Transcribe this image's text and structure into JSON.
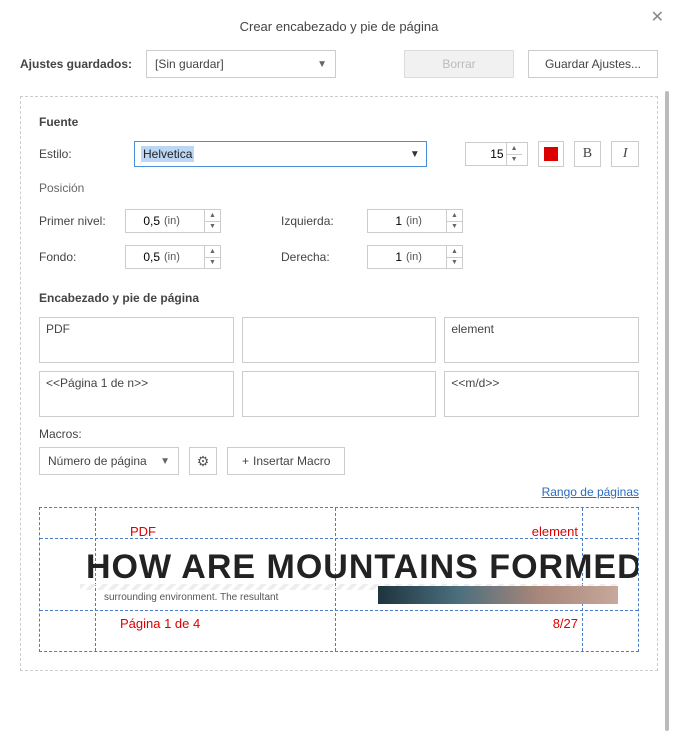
{
  "title": "Crear encabezado y pie de página",
  "top": {
    "saved_label": "Ajustes guardados:",
    "saved_value": "[Sin guardar]",
    "delete": "Borrar",
    "save": "Guardar Ajustes..."
  },
  "font": {
    "section": "Fuente",
    "style_label": "Estilo:",
    "family": "Helvetica",
    "size": "15",
    "color": "#d00000",
    "bold": "B",
    "italic": "I"
  },
  "position": {
    "section": "Posición",
    "first_label": "Primer nivel:",
    "first_value": "0,5",
    "first_unit": "(in)",
    "left_label": "Izquierda:",
    "left_value": "1",
    "left_unit": "(in)",
    "bottom_label": "Fondo:",
    "bottom_value": "0,5",
    "bottom_unit": "(in)",
    "right_label": "Derecha:",
    "right_value": "1",
    "right_unit": "(in)"
  },
  "hf": {
    "section": "Encabezado y pie de página",
    "h_left": "PDF",
    "h_center": "",
    "h_right": "element",
    "f_left": "<<Página 1 de n>>",
    "f_center": "",
    "f_right": "<<m/d>>"
  },
  "macros": {
    "label": "Macros:",
    "selected": "Número de página",
    "insert": "Insertar Macro",
    "range_link": "Rango de páginas"
  },
  "preview": {
    "headline": "HOW ARE MOUNTAINS FORMED?",
    "body": "surrounding   environment.   The   resultant",
    "ov_hl": "PDF",
    "ov_hr": "element",
    "ov_fl": "Página 1 de 4",
    "ov_fr": "8/27"
  }
}
